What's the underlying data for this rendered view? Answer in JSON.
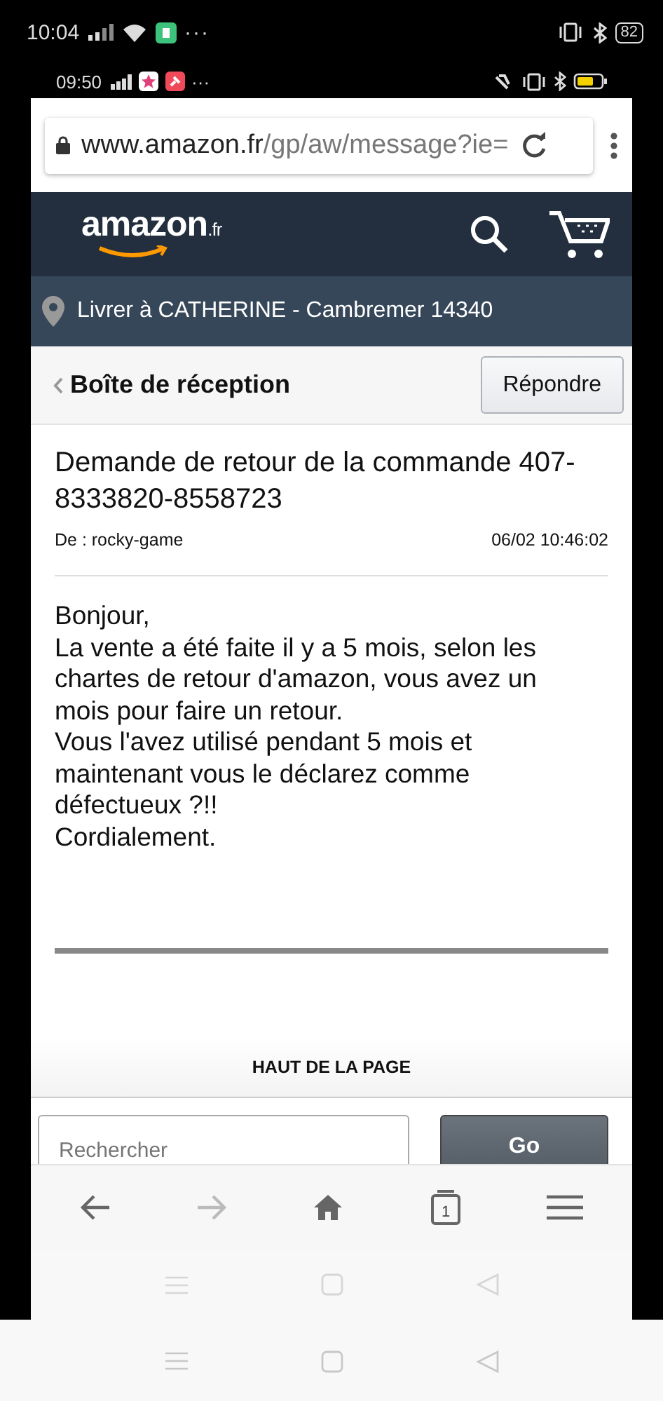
{
  "outer_status": {
    "time": "10:04",
    "more": "···",
    "battery": "82"
  },
  "inner_status": {
    "time": "09:50",
    "more": "···"
  },
  "address_bar": {
    "domain": "www.amazon.fr",
    "path": "/gp/aw/message?ie="
  },
  "header": {
    "logo": "amazon",
    "logo_suffix": ".fr",
    "location": "Livrer à CATHERINE - Cambremer 14340"
  },
  "inbox": {
    "back_label": "Boîte de réception",
    "reply_button": "Répondre"
  },
  "message": {
    "subject": "Demande de retour de la commande 407-8333820-8558723",
    "from": "De : rocky-game",
    "date": "06/02 10:46:02",
    "body": [
      "Bonjour,",
      "La vente a été faite il y a 5 mois, selon les chartes de retour d'amazon, vous avez un mois pour faire un retour.",
      "Vous l'avez utilisé pendant 5 mois et maintenant vous le déclarez comme défectueux ?!!",
      "Cordialement."
    ]
  },
  "back_to_top": "HAUT DE LA PAGE",
  "search": {
    "placeholder": "Rechercher",
    "button": "Go"
  },
  "toolbar": [
    {
      "kind": "back",
      "disabled": false
    },
    {
      "kind": "forward",
      "disabled": true
    },
    {
      "kind": "home",
      "disabled": false
    },
    {
      "kind": "tabs",
      "count": "1",
      "disabled": false
    },
    {
      "kind": "menu",
      "disabled": false
    }
  ]
}
